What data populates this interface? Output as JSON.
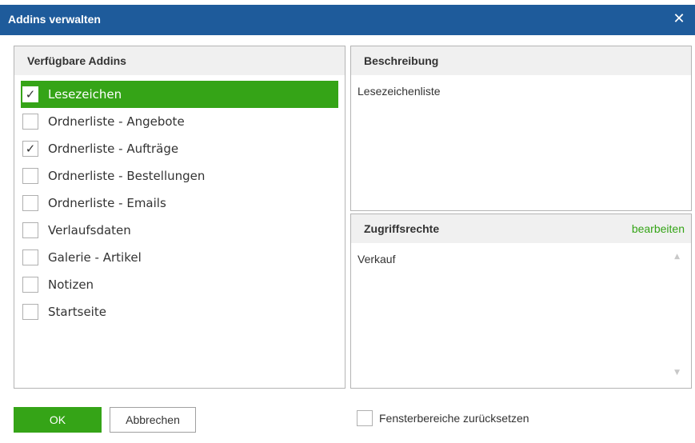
{
  "window": {
    "title": "Addins verwalten",
    "close_glyph": "✕"
  },
  "addins": {
    "header": "Verfügbare Addins",
    "items": [
      {
        "label": "Lesezeichen",
        "checked": true,
        "selected": true
      },
      {
        "label": "Ordnerliste - Angebote",
        "checked": false,
        "selected": false
      },
      {
        "label": "Ordnerliste - Aufträge",
        "checked": true,
        "selected": false
      },
      {
        "label": "Ordnerliste - Bestellungen",
        "checked": false,
        "selected": false
      },
      {
        "label": "Ordnerliste - Emails",
        "checked": false,
        "selected": false
      },
      {
        "label": "Verlaufsdaten",
        "checked": false,
        "selected": false
      },
      {
        "label": "Galerie - Artikel",
        "checked": false,
        "selected": false
      },
      {
        "label": "Notizen",
        "checked": false,
        "selected": false
      },
      {
        "label": "Startseite",
        "checked": false,
        "selected": false
      }
    ]
  },
  "description": {
    "header": "Beschreibung",
    "text": "Lesezeichenliste"
  },
  "rights": {
    "header": "Zugriffsrechte",
    "edit_label": "bearbeiten",
    "text": "Verkauf"
  },
  "footer": {
    "ok_label": "OK",
    "cancel_label": "Abbrechen",
    "reset_label": "Fensterbereiche zurücksetzen",
    "reset_checked": false
  },
  "colors": {
    "accent": "#35a417",
    "titlebar": "#1e5b9b"
  }
}
